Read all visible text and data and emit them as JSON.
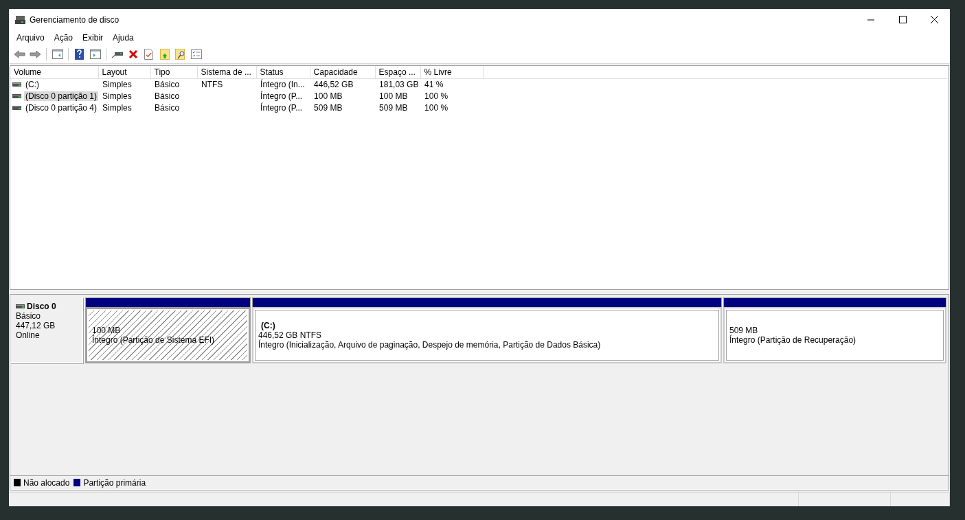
{
  "window": {
    "title": "Gerenciamento de disco"
  },
  "menu": [
    "Arquivo",
    "Ação",
    "Exibir",
    "Ajuda"
  ],
  "volume_table": {
    "columns": [
      "Volume",
      "Layout",
      "Tipo",
      "Sistema de ...",
      "Status",
      "Capacidade",
      "Espaço ...",
      "% Livre"
    ],
    "rows": [
      {
        "volume": "(C:)",
        "layout": "Simples",
        "tipo": "Básico",
        "sistema": "NTFS",
        "status": "Íntegro (In...",
        "capacidade": "446,52 GB",
        "espaco": "181,03 GB",
        "livre": "41 %",
        "selected": false
      },
      {
        "volume": "(Disco 0 partição 1)",
        "layout": "Simples",
        "tipo": "Básico",
        "status": "Íntegro (P...",
        "capacidade": "100 MB",
        "espaco": "100 MB",
        "livre": "100 %",
        "selected": true
      },
      {
        "volume": "(Disco 0 partição 4)",
        "layout": "Simples",
        "tipo": "Básico",
        "status": "Íntegro (P...",
        "capacidade": "509 MB",
        "espaco": "509 MB",
        "livre": "100 %",
        "selected": false
      }
    ]
  },
  "disks": [
    {
      "name": "Disco 0",
      "type": "Básico",
      "size": "447,12 GB",
      "state": "Online",
      "partitions": [
        {
          "size": "100 MB",
          "status": "Íntegro (Partição de Sistema EFI)",
          "selected": true
        },
        {
          "label": "(C:)",
          "size": "446,52 GB NTFS",
          "status": "Íntegro (Inicialização, Arquivo de paginação, Despejo de memória, Partição de Dados Básica)",
          "selected": false
        },
        {
          "size": "509 MB",
          "status": "Íntegro (Partição de Recuperação)",
          "selected": false
        }
      ]
    }
  ],
  "legend": [
    {
      "label": "Não alocado",
      "color": "#000000"
    },
    {
      "label": "Partição primária",
      "color": "#000080"
    }
  ]
}
